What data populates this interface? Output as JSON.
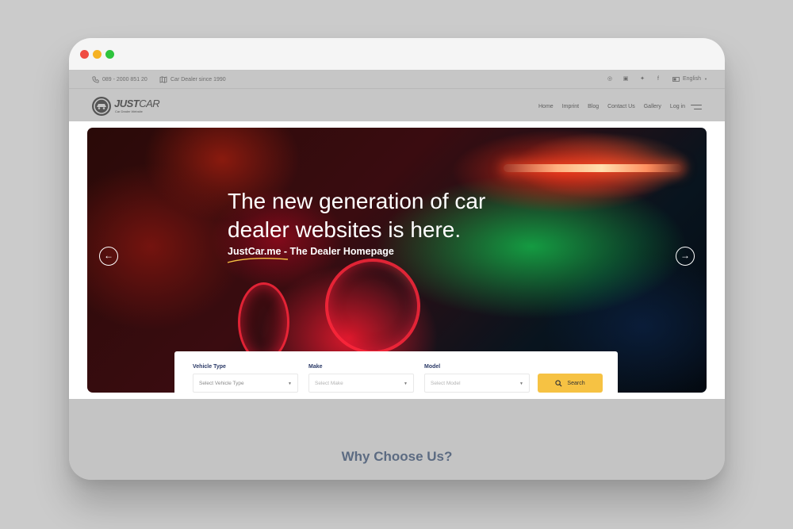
{
  "window": {
    "controls": [
      "close",
      "minimize",
      "maximize"
    ]
  },
  "topbar": {
    "phone": "089 - 2000 851 20",
    "tagline": "Car Dealer since 1990",
    "social_icons": [
      "whatsapp-icon",
      "instagram-icon",
      "twitter-icon",
      "facebook-icon"
    ],
    "language": "English"
  },
  "header": {
    "logo": {
      "brand_bold": "JUST",
      "brand_light": "CAR",
      "tagline": "Car Dealer Website"
    },
    "nav": [
      "Home",
      "Imprint",
      "Blog",
      "Contact Us",
      "Gallery",
      "Log in"
    ]
  },
  "hero": {
    "title_line1": "The new generation of car",
    "title_line2": "dealer websites is here.",
    "subtitle": "JustCar.me - The Dealer Homepage",
    "prev_icon": "arrow-left-icon",
    "next_icon": "arrow-right-icon"
  },
  "search": {
    "fields": [
      {
        "label": "Vehicle Type",
        "placeholder": "Select Vehicle Type"
      },
      {
        "label": "Make",
        "placeholder": "Select Make"
      },
      {
        "label": "Model",
        "placeholder": "Select Model"
      }
    ],
    "button_label": "Search",
    "accent_color": "#f6c243"
  },
  "section": {
    "title": "Why Choose Us?"
  }
}
